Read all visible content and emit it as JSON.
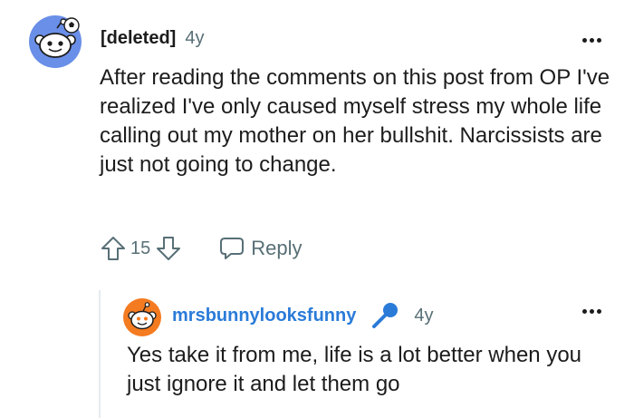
{
  "comment": {
    "author": "[deleted]",
    "age": "4y",
    "body": "After reading the comments on this post from OP I've realized I've only caused myself stress my whole life calling out my mother on her bullshit. Narcissists are just not going to change.",
    "score": "15",
    "reply_label": "Reply"
  },
  "reply": {
    "author": "mrsbunnylooksfunny",
    "age": "4y",
    "body": "Yes take it from me, life is a lot better when you just ignore it and let them go",
    "flair_icon": "microphone-icon"
  },
  "colors": {
    "avatar_main_bg": "#6a8fe8",
    "avatar_reply_bg": "#f47b20",
    "username_link": "#2a7bd8",
    "muted_text": "#576f76",
    "thread_line": "#e5ebee"
  }
}
